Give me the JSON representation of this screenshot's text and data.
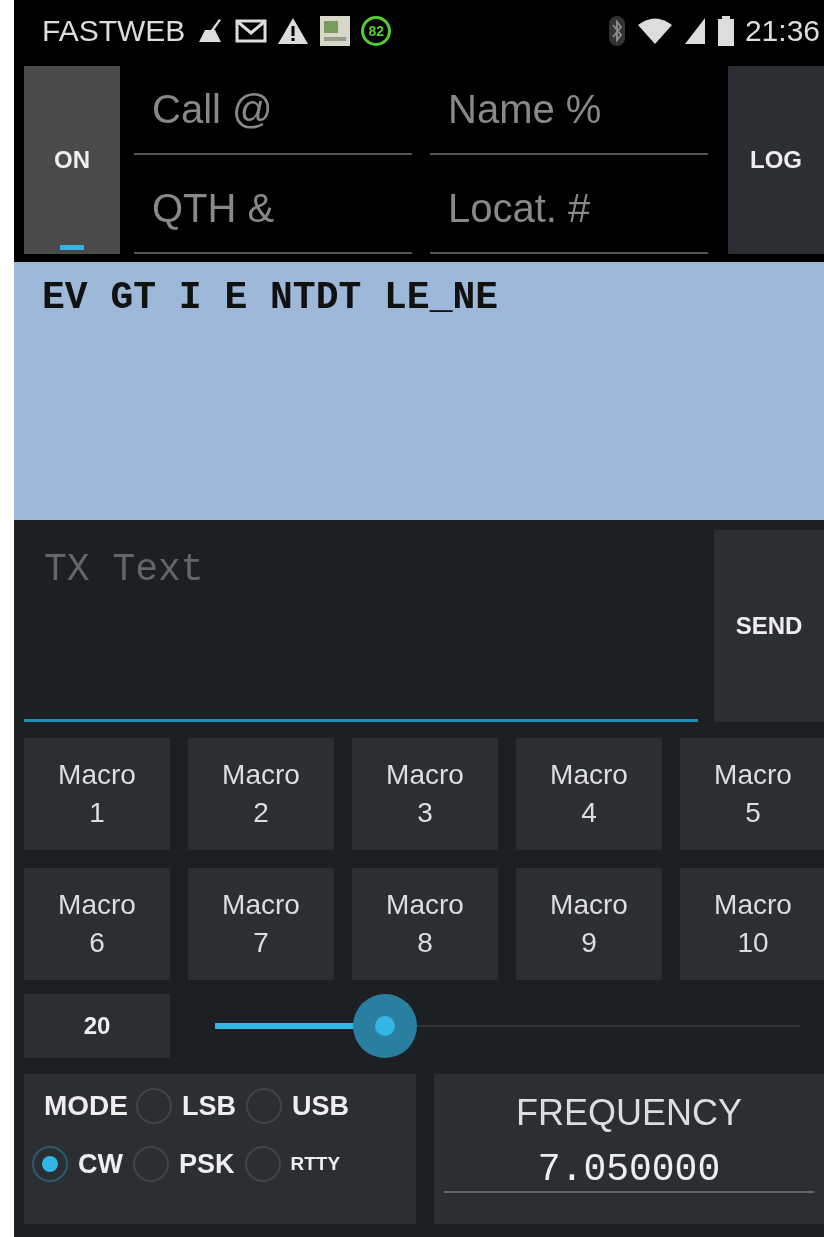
{
  "status_bar": {
    "carrier": "FASTWEB",
    "badge": "82",
    "time": "21:36"
  },
  "header": {
    "power_button": "ON",
    "power_on": true,
    "fields": [
      {
        "placeholder": "Call @"
      },
      {
        "placeholder": "Name %"
      },
      {
        "placeholder": "QTH &"
      },
      {
        "placeholder": "Locat. #"
      }
    ],
    "log_button": "LOG"
  },
  "rx_text": "EV GT I E NTDT LE_NE",
  "tx": {
    "placeholder": "TX Text",
    "send_button": "SEND"
  },
  "macros": [
    {
      "label": "Macro",
      "number": "1"
    },
    {
      "label": "Macro",
      "number": "2"
    },
    {
      "label": "Macro",
      "number": "3"
    },
    {
      "label": "Macro",
      "number": "4"
    },
    {
      "label": "Macro",
      "number": "5"
    },
    {
      "label": "Macro",
      "number": "6"
    },
    {
      "label": "Macro",
      "number": "7"
    },
    {
      "label": "Macro",
      "number": "8"
    },
    {
      "label": "Macro",
      "number": "9"
    },
    {
      "label": "Macro",
      "number": "10"
    }
  ],
  "speed": {
    "value": "20",
    "level": 0.29
  },
  "mode": {
    "label": "MODE",
    "options": [
      {
        "label": "LSB",
        "selected": false
      },
      {
        "label": "USB",
        "selected": false
      },
      {
        "label": "CW",
        "selected": true
      },
      {
        "label": "PSK",
        "selected": false
      },
      {
        "label": "RTTY",
        "selected": false
      }
    ]
  },
  "frequency": {
    "label": "FREQUENCY",
    "value": "7.050000"
  }
}
